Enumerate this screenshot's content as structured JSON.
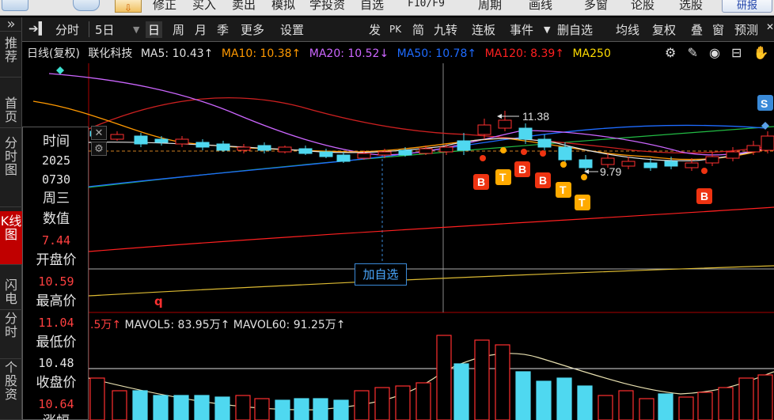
{
  "menubar": {
    "items": [
      "修正",
      "买入",
      "卖出",
      "模拟",
      "学投资",
      "自选",
      "F10/F9",
      "周期",
      "画线",
      "多窗",
      "论股",
      "选股"
    ],
    "research_label": "研报"
  },
  "leftnav": {
    "items": [
      {
        "label": "推荐",
        "active": false
      },
      {
        "label": "首页",
        "active": false
      },
      {
        "label": "分时图",
        "active": false
      },
      {
        "label": "K线图",
        "active": true
      },
      {
        "label": "闪电",
        "active": false
      },
      {
        "label": "分时",
        "active": false
      },
      {
        "label": "个股资",
        "active": false
      }
    ],
    "collapse": "»"
  },
  "toolbar": {
    "left": [
      "分时",
      "5日",
      "日",
      "周",
      "月",
      "季",
      "更多",
      "设置"
    ],
    "right": [
      "发",
      "PK",
      "简",
      "九转",
      "连板",
      "事件",
      "删自选",
      "均线",
      "复权",
      "叠",
      "窗",
      "预测"
    ]
  },
  "legend": {
    "period": "日线(复权)",
    "stock": "联化科技",
    "ma": [
      {
        "label": "MA5: 10.43↑",
        "color": "#e0e0e0"
      },
      {
        "label": "MA10: 10.38↑",
        "color": "#ff9900"
      },
      {
        "label": "MA20: 10.52↓",
        "color": "#cc66ff"
      },
      {
        "label": "MA50: 10.78↑",
        "color": "#1e6bff"
      },
      {
        "label": "MA120: 8.39↑",
        "color": "#ff2020"
      },
      {
        "label": "MA250",
        "color": "#ffdd00"
      }
    ],
    "icons": [
      "gear-icon",
      "pen-icon",
      "eye-icon",
      "lock-icon",
      "hand-icon"
    ]
  },
  "info": {
    "time_label": "时间",
    "year": "2025",
    "date": "0730",
    "weekday": "周三",
    "value_label": "数值",
    "value": "7.44",
    "open_label": "开盘价",
    "open": "10.59",
    "high_label": "最高价",
    "high": "11.04",
    "low_label": "最低价",
    "low": "10.48",
    "close_label": "收盘价",
    "close": "10.64",
    "change_label": "涨幅"
  },
  "annotations": {
    "high_price": "11.38",
    "low_price": "9.79",
    "s_badge": "S",
    "b_label": "B",
    "t_label": "T",
    "add_watch": "加自选",
    "q_mark": "q"
  },
  "volume_legend": {
    "prefix": ".5万↑",
    "mavol5": "MAVOL5: 83.95万↑",
    "mavol60": "MAVOL60: 91.25万↑"
  },
  "colors": {
    "up": "#ff3030",
    "down": "#4fd8f0",
    "ma5": "#e0e0e0",
    "ma10": "#ff9900",
    "ma20": "#cc66ff",
    "ma50": "#1e6bff",
    "ma120": "#ff2020",
    "ma250": "#ffdd00",
    "signal_b": "#ee3311",
    "signal_t": "#ffaa00"
  }
}
